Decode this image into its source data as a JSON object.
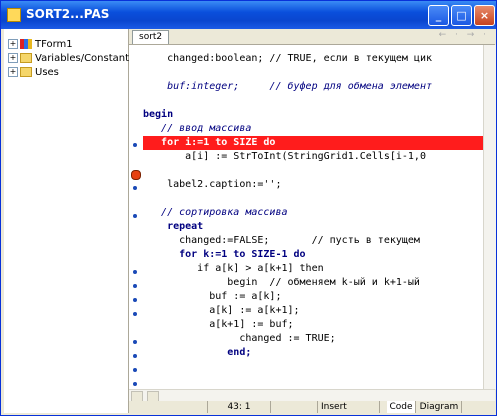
{
  "window": {
    "title": "SORT2...PAS",
    "minimize_label": "_",
    "maximize_label": "□",
    "close_label": "×"
  },
  "tree": {
    "items": [
      {
        "label": "TForm1",
        "icon": "class-icon"
      },
      {
        "label": "Variables/Constants",
        "icon": "folder-icon"
      },
      {
        "label": "Uses",
        "icon": "folder-icon"
      }
    ]
  },
  "editor": {
    "tab_label": "sort2",
    "nav_arrows": "← · → ·",
    "lines": [
      "    changed:boolean; // TRUE, если в текущем цик",
      "",
      "    buf:integer;     // буфер для обмена элемент",
      "",
      "begin",
      "   // ввод массива",
      "   for i:=1 to SIZE do",
      "       a[i] := StrToInt(StringGrid1.Cells[i-1,0",
      "",
      "    label2.caption:='';",
      "",
      "   // сортировка массива",
      "    repeat",
      "      changed:=FALSE;       // пусть в текущем",
      "      for k:=1 to SIZE-1 do",
      "         if a[k] > a[k+1] then",
      "              begin  // обменяем k-ый и k+1-ый",
      "           buf := a[k];",
      "           a[k] := a[k+1];",
      "           a[k+1] := buf;",
      "                changed := TRUE;",
      "              end;"
    ]
  },
  "status": {
    "position": "43:  1",
    "mode": "Insert",
    "code_tab": "Code",
    "diagram_tab": "Diagram"
  }
}
